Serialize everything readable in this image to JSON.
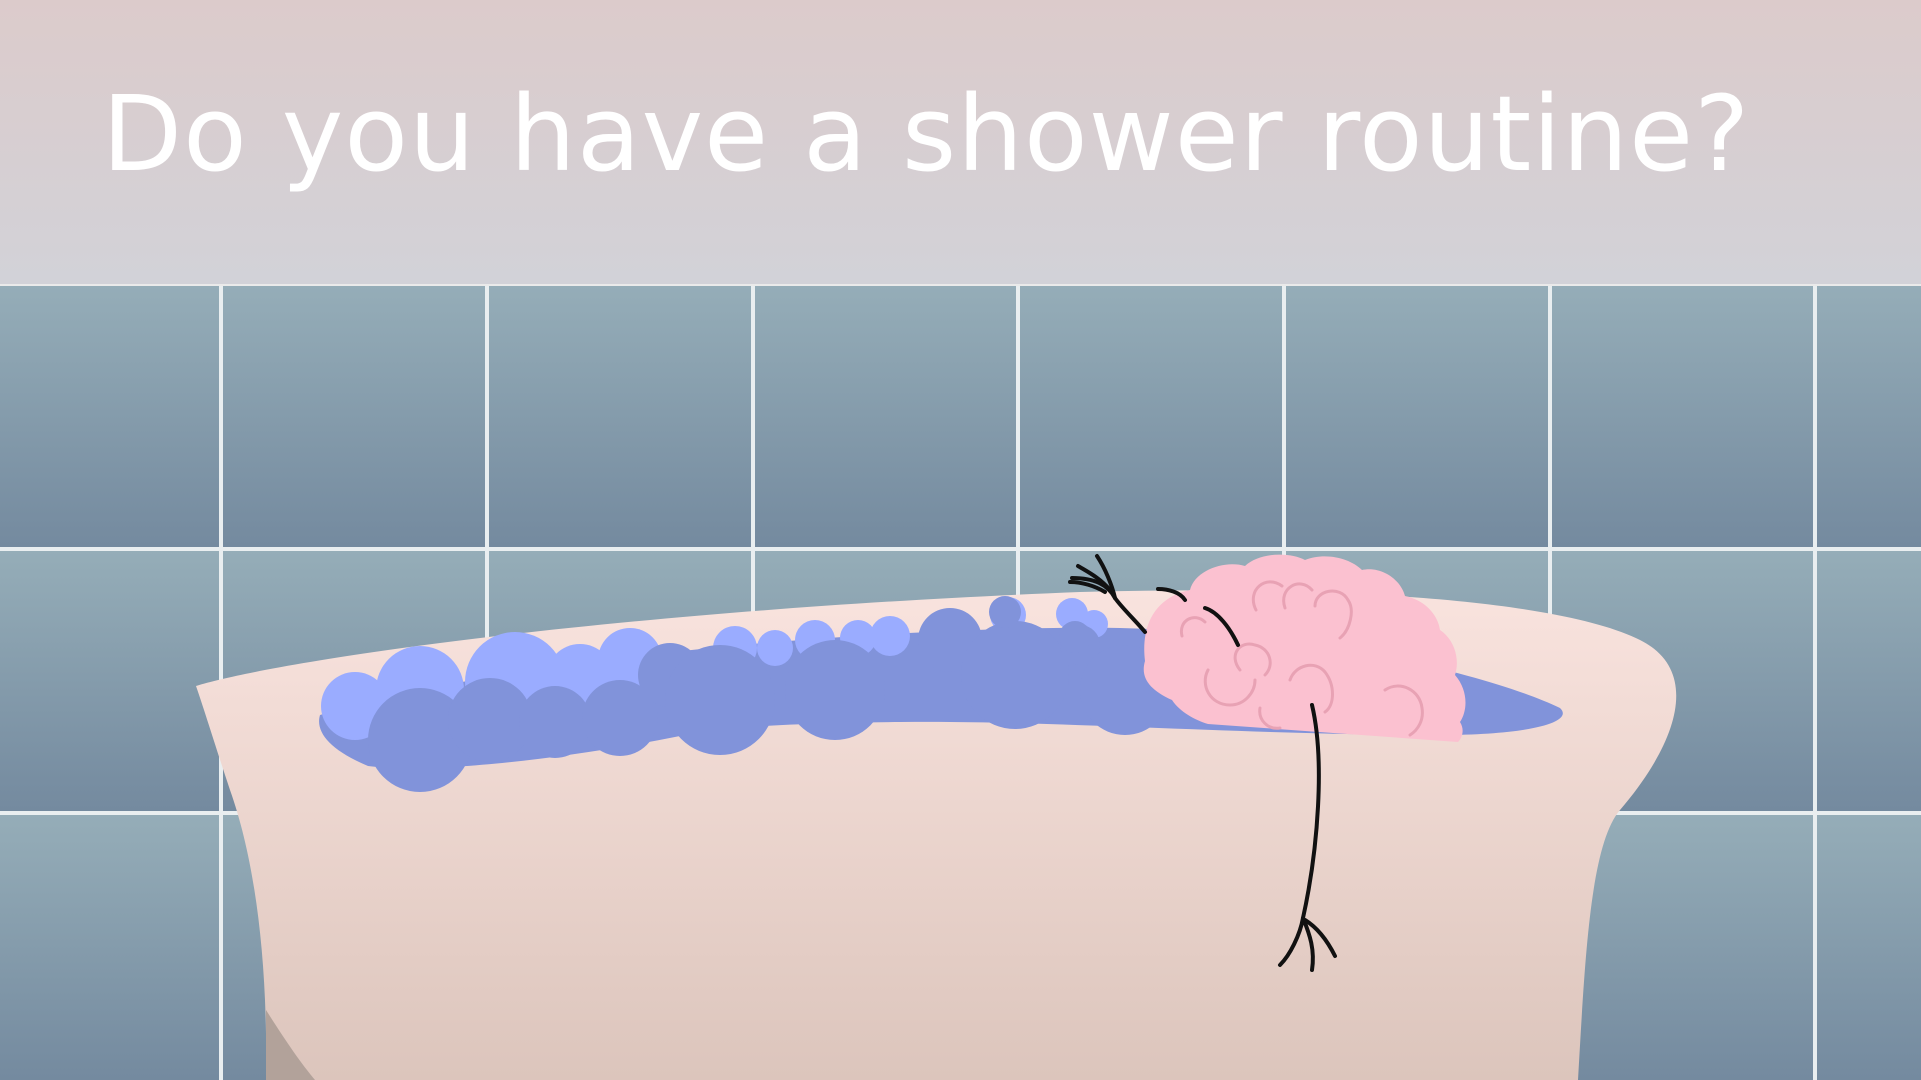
{
  "slide": {
    "headline": "Do you have a shower routine?"
  },
  "palette": {
    "header_top": "#dccbcb",
    "header_bottom": "#d2d2d8",
    "tile_top": "#95adb8",
    "tile_bottom": "#748a9f",
    "grout": "#e9eef0",
    "tub_top": "#f7e1dc",
    "tub_bottom": "#dcc5bc",
    "water": "#8193da",
    "foam_light": "#9aacff",
    "foam_mid": "#8193da",
    "brain_pink": "#fbc1d0",
    "brain_fold": "#e8a2b4",
    "line": "#111111",
    "text": "#ffffff"
  },
  "icons": {
    "brain": "brain-character-icon",
    "bathtub": "bathtub-icon",
    "bubbles": "foam-bubbles-icon"
  }
}
